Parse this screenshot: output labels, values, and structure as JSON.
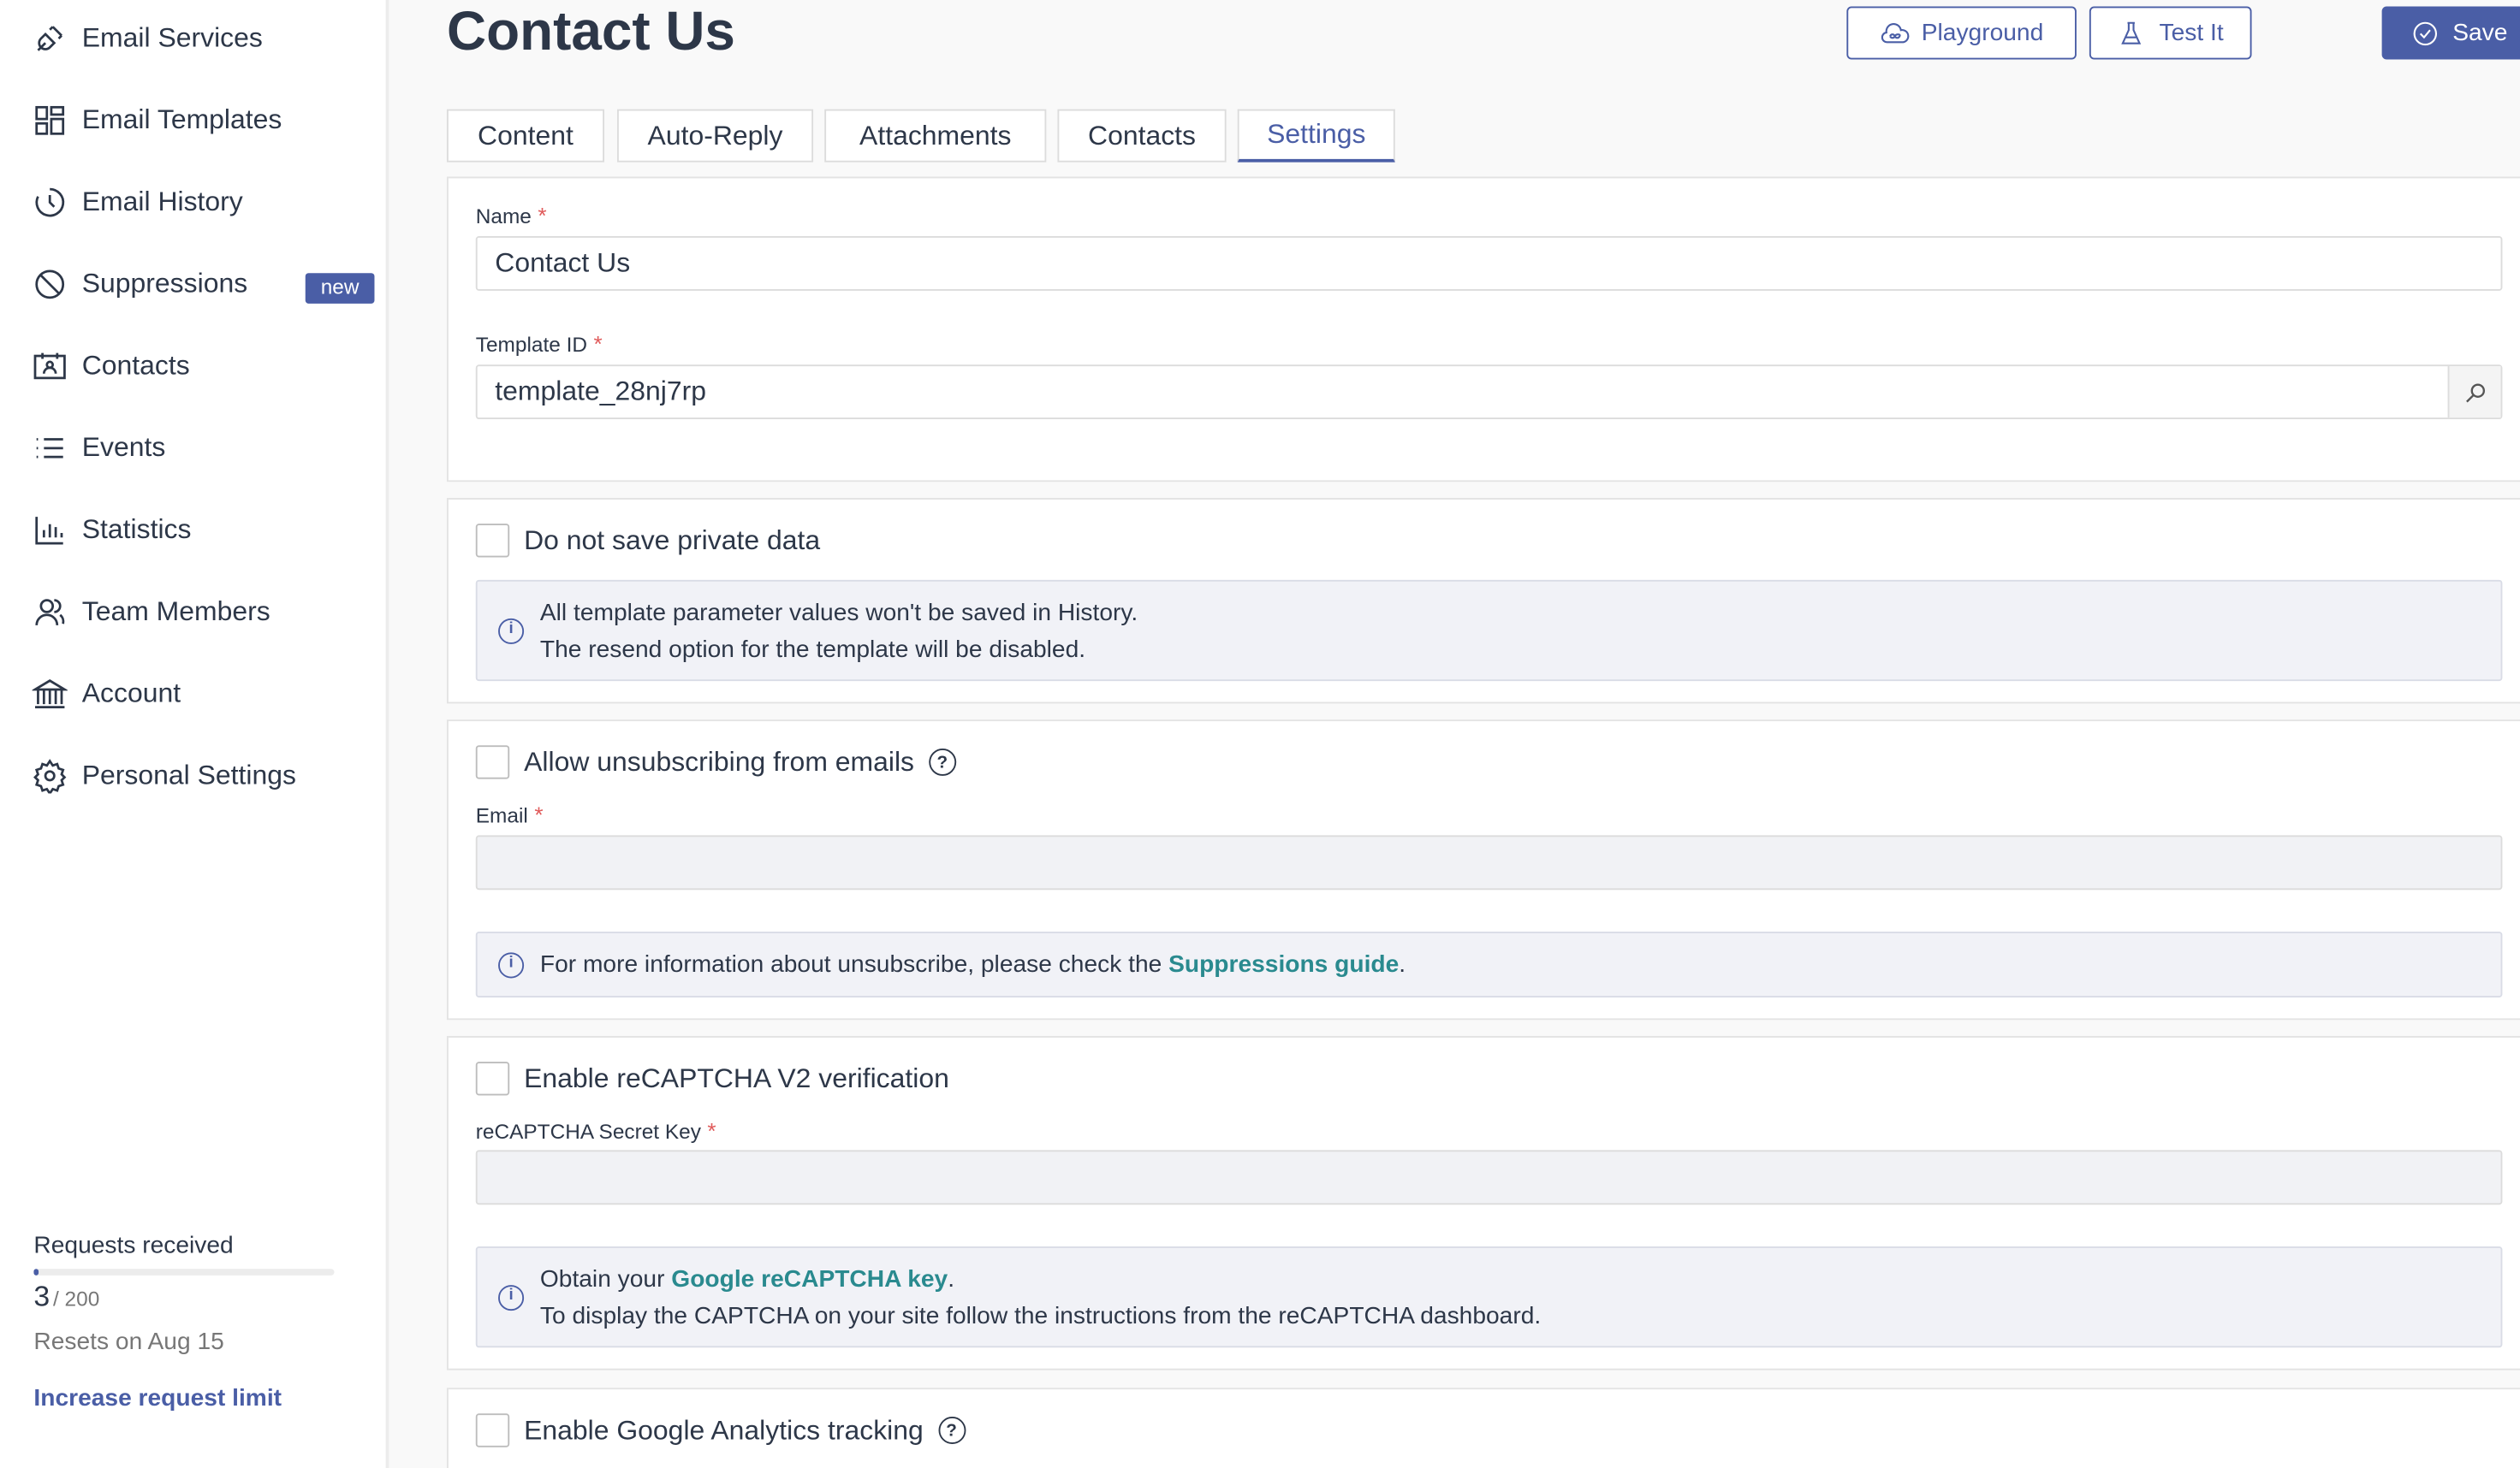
{
  "sidebar": {
    "items": [
      {
        "label": "Email Services",
        "icon": "plug-icon"
      },
      {
        "label": "Email Templates",
        "icon": "templates-icon"
      },
      {
        "label": "Email History",
        "icon": "history-icon"
      },
      {
        "label": "Suppressions",
        "icon": "block-icon",
        "badge": "new"
      },
      {
        "label": "Contacts",
        "icon": "contact-card-icon"
      },
      {
        "label": "Events",
        "icon": "list-icon"
      },
      {
        "label": "Statistics",
        "icon": "bar-chart-icon"
      },
      {
        "label": "Team Members",
        "icon": "users-icon"
      },
      {
        "label": "Account",
        "icon": "bank-icon"
      },
      {
        "label": "Personal Settings",
        "icon": "gear-icon"
      }
    ],
    "usage": {
      "label": "Requests received",
      "used": "3",
      "limit": "/ 200",
      "progress": 0.015,
      "resets": "Resets on Aug 15",
      "increase_link": "Increase request limit"
    }
  },
  "header": {
    "title": "Contact Us",
    "playground": "Playground",
    "test": "Test It",
    "save": "Save"
  },
  "tabs": [
    {
      "label": "Content"
    },
    {
      "label": "Auto-Reply"
    },
    {
      "label": "Attachments"
    },
    {
      "label": "Contacts"
    },
    {
      "label": "Settings",
      "active": true
    }
  ],
  "settings": {
    "name_label": "Name",
    "name_value": "Contact Us",
    "template_id_label": "Template ID",
    "template_id_value": "template_28nj7rp",
    "private": {
      "label": "Do not save private data",
      "checked": false,
      "info1": "All template parameter values won't be saved in History.",
      "info2": "The resend option for the template will be disabled."
    },
    "unsub": {
      "label": "Allow unsubscribing from emails",
      "checked": false,
      "email_label": "Email",
      "email_value": "",
      "info_pre": "For more information about unsubscribe, please check the ",
      "info_link": "Suppressions guide",
      "info_post": "."
    },
    "recaptcha": {
      "label": "Enable reCAPTCHA V2 verification",
      "checked": false,
      "key_label": "reCAPTCHA Secret Key",
      "key_value": "",
      "info_pre": "Obtain your ",
      "info_link": "Google reCAPTCHA key",
      "info_post": ".",
      "info2": "To display the CAPTCHA on your site follow the instructions from the reCAPTCHA dashboard."
    },
    "analytics": {
      "label": "Enable Google Analytics tracking",
      "checked": false
    }
  },
  "colors": {
    "primary": "#4a5ea6",
    "link": "#2a8a8f",
    "required": "#e05a5a"
  }
}
